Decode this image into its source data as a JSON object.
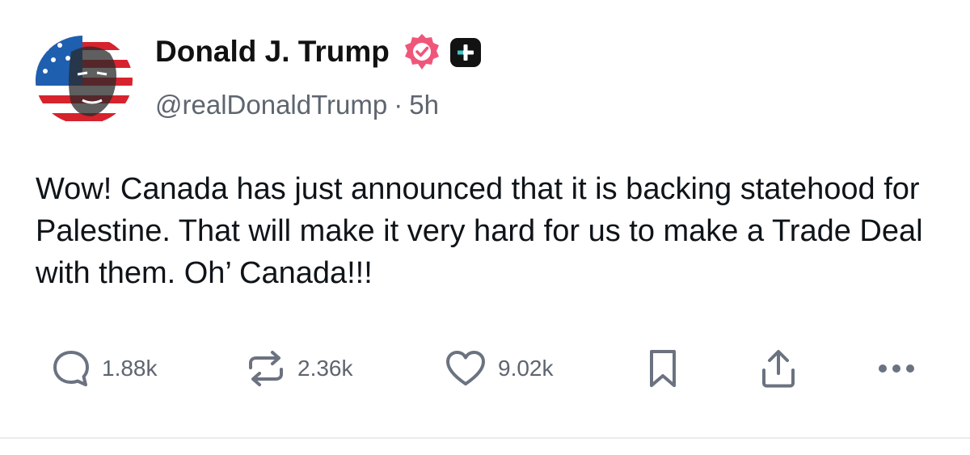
{
  "post": {
    "author": {
      "name": "Donald J. Trump",
      "handle": "@realDonaldTrump",
      "separator": "·",
      "timestamp": "5h",
      "avatar_icon": "avatar-flag-portrait",
      "verified_icon": "verified-badge-icon",
      "plus_icon": "plus-badge-icon"
    },
    "text": "Wow! Canada has just announced that it is backing statehood for Palestine. That will make it very hard for us to make a Trade Deal with them. Oh’ Canada!!!",
    "actions": {
      "replies": {
        "icon": "comment-icon",
        "count": "1.88k"
      },
      "reposts": {
        "icon": "repost-icon",
        "count": "2.36k"
      },
      "likes": {
        "icon": "heart-icon",
        "count": "9.02k"
      },
      "bookmark": {
        "icon": "bookmark-icon"
      },
      "share": {
        "icon": "share-icon"
      },
      "more": {
        "icon": "more-icon"
      }
    },
    "colors": {
      "verified": "#f0567a",
      "text": "#0f1419",
      "muted": "#5e6570",
      "icon": "#6b7280",
      "plus_badge": "#121212"
    }
  }
}
